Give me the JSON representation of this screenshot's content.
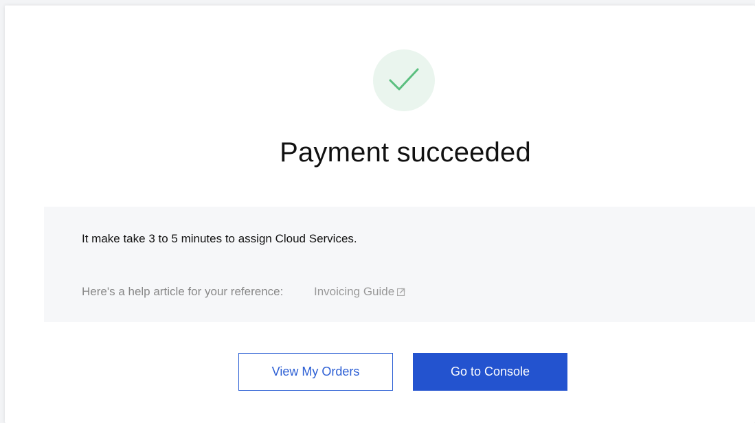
{
  "status": {
    "icon": "check-icon",
    "icon_color": "#5bbf7f",
    "title": "Payment succeeded"
  },
  "info": {
    "message": "It make take 3 to 5 minutes to assign Cloud Services.",
    "help_prefix": "Here's a help article for your reference:",
    "help_link_label": "Invoicing Guide",
    "help_link_icon": "external-link-icon"
  },
  "actions": {
    "view_orders_label": "View My Orders",
    "console_label": "Go to Console",
    "accent_color": "#2353cf"
  }
}
